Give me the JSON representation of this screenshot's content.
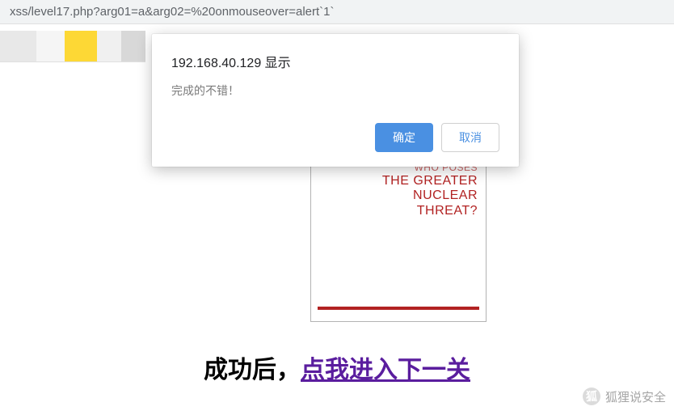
{
  "url_bar": "xss/level17.php?arg01=a&arg02=%20onmouseover=alert`1`",
  "dialog": {
    "title": "192.168.40.129 显示",
    "message": "完成的不错！",
    "ok_label": "确定",
    "cancel_label": "取消"
  },
  "flash": {
    "line_top": "WHO POSES",
    "line1": "THE GREATER",
    "line2": "NUCLEAR",
    "line3": "THREAT?"
  },
  "bottom": {
    "prefix": "成功后，",
    "link": "点我进入下一关"
  },
  "watermark": {
    "icon": "狐",
    "text": "狐狸说安全"
  }
}
